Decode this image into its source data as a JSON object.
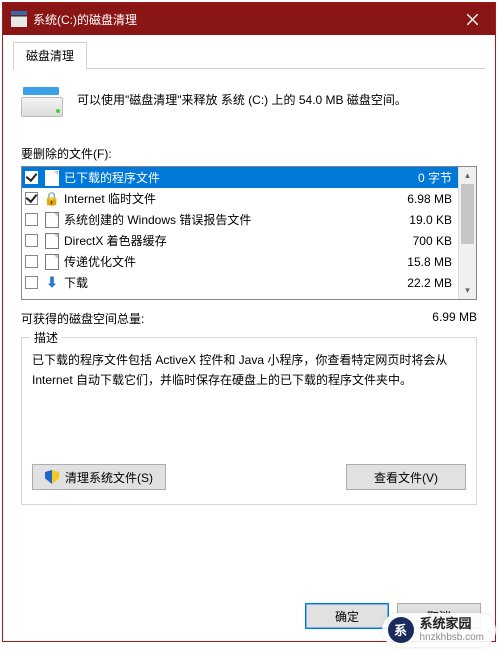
{
  "window": {
    "title": "系统(C:)的磁盘清理"
  },
  "tab": {
    "label": "磁盘清理"
  },
  "intro": {
    "text": "可以使用\"磁盘清理\"来释放 系统 (C:) 上的 54.0 MB 磁盘空间。"
  },
  "files": {
    "label": "要删除的文件(F):",
    "items": [
      {
        "name": "已下载的程序文件",
        "size": "0 字节",
        "checked": true,
        "selected": true,
        "icon": "page"
      },
      {
        "name": "Internet 临时文件",
        "size": "6.98 MB",
        "checked": true,
        "selected": false,
        "icon": "lock"
      },
      {
        "name": "系统创建的 Windows 错误报告文件",
        "size": "19.0 KB",
        "checked": false,
        "selected": false,
        "icon": "page"
      },
      {
        "name": "DirectX 着色器缓存",
        "size": "700 KB",
        "checked": false,
        "selected": false,
        "icon": "page"
      },
      {
        "name": "传递优化文件",
        "size": "15.8 MB",
        "checked": false,
        "selected": false,
        "icon": "page"
      },
      {
        "name": "下载",
        "size": "22.2 MB",
        "checked": false,
        "selected": false,
        "icon": "down"
      }
    ]
  },
  "total": {
    "label": "可获得的磁盘空间总量:",
    "value": "6.99 MB"
  },
  "desc": {
    "legend": "描述",
    "text": "已下载的程序文件包括 ActiveX 控件和 Java 小程序，你查看特定网页时将会从 Internet 自动下载它们，并临时保存在硬盘上的已下载的程序文件夹中。"
  },
  "buttons": {
    "clean_system": "清理系统文件(S)",
    "view_files": "查看文件(V)",
    "ok": "确定",
    "cancel": "取消"
  },
  "watermark": {
    "logo": "系",
    "line1": "系统家园",
    "line2": "hnzkhbsb.com"
  }
}
